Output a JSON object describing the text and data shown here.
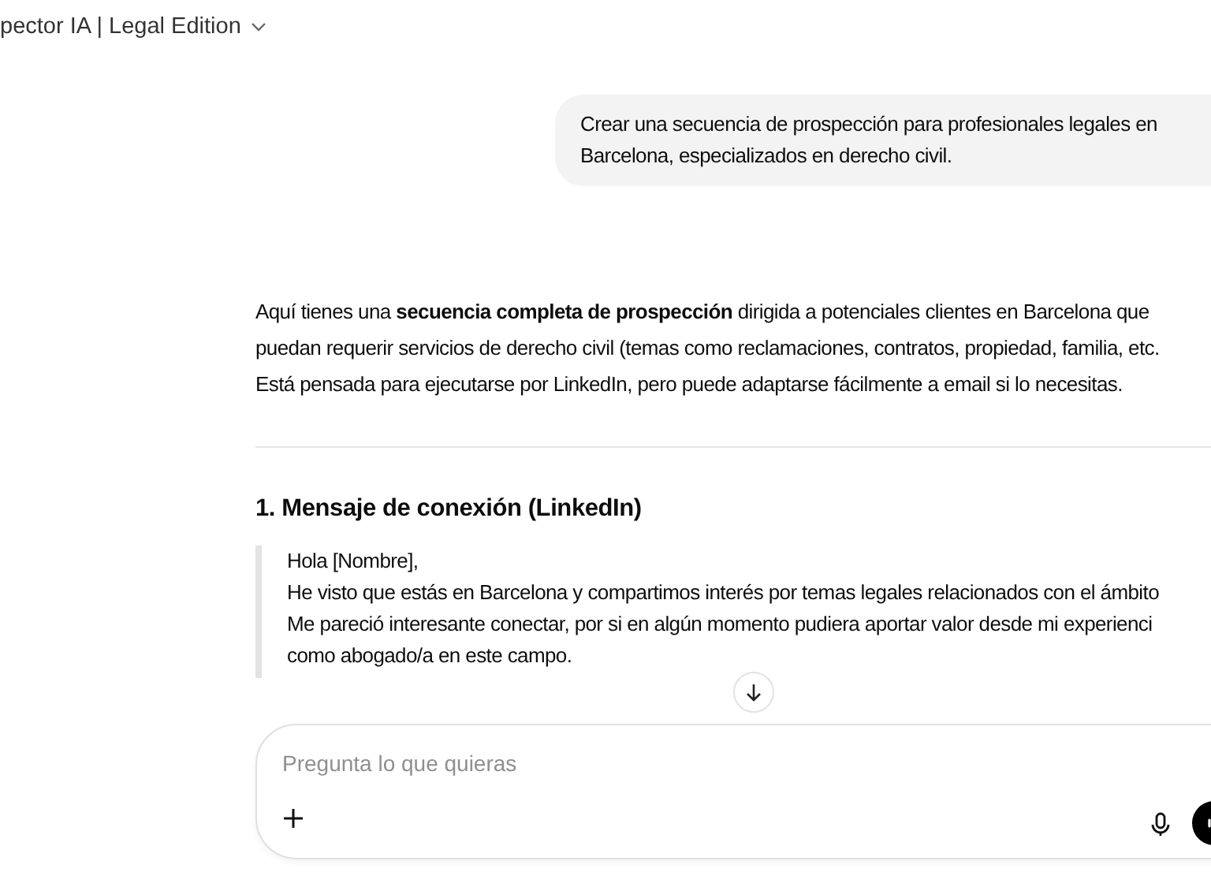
{
  "header": {
    "title": "pector IA | Legal Edition"
  },
  "user_message": {
    "lines": [
      "Crear una secuencia de prospección para profesionales legales en",
      "Barcelona, especializados en derecho civil."
    ]
  },
  "assistant": {
    "intro_lines": [
      "Aquí tienes una **secuencia completa de prospección** dirigida a potenciales clientes en Barcelona que",
      "puedan requerir servicios de derecho civil (temas como reclamaciones, contratos, propiedad, familia, etc.",
      "Está pensada para ejecutarse por LinkedIn, pero puede adaptarse fácilmente a email si lo necesitas."
    ],
    "section_heading": "1. Mensaje de conexión (LinkedIn)",
    "quote_lines": [
      "Hola [Nombre],",
      "He visto que estás en Barcelona y compartimos interés por temas legales relacionados con el ámbito",
      "Me pareció interesante conectar, por si en algún momento pudiera aportar valor desde mi experienci",
      "como abogado/a en este campo."
    ]
  },
  "composer": {
    "placeholder": "Pregunta lo que quieras"
  }
}
